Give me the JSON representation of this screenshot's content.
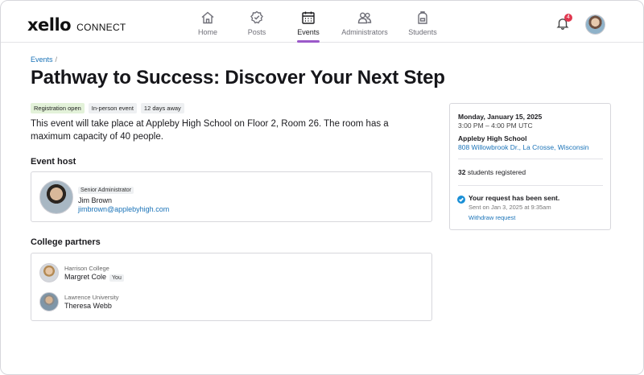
{
  "app": {
    "logo_word": "xello",
    "logo_sub": "CONNECT",
    "notification_count": "4"
  },
  "nav": {
    "items": [
      {
        "label": "Home",
        "icon": "home-icon"
      },
      {
        "label": "Posts",
        "icon": "badge-check-icon"
      },
      {
        "label": "Events",
        "icon": "calendar-icon",
        "active": true
      },
      {
        "label": "Administrators",
        "icon": "users-icon"
      },
      {
        "label": "Students",
        "icon": "backpack-icon"
      }
    ]
  },
  "breadcrumb": {
    "parent": "Events",
    "separator": "/"
  },
  "event": {
    "title": "Pathway to Success: Discover Your Next Step",
    "tags": [
      "Registration open",
      "In-person event",
      "12 days away"
    ],
    "description": "This event will take place at Appleby High School on Floor 2, Room 26. The room has a maximum capacity of 40 people."
  },
  "host": {
    "heading": "Event host",
    "role": "Senior Administrator",
    "name": "Jim Brown",
    "email": "jimbrown@applebyhigh.com"
  },
  "partners": {
    "heading": "College partners",
    "items": [
      {
        "school": "Harrison College",
        "name": "Margret Cole",
        "you_label": "You"
      },
      {
        "school": "Lawrence University",
        "name": "Theresa Webb",
        "you_label": ""
      }
    ]
  },
  "details": {
    "date": "Monday, January 15, 2025",
    "time": "3:00 PM – 4:00 PM UTC",
    "school": "Appleby High School",
    "address": "808 Willowbrook Dr., La Crosse, Wisconsin",
    "registered_count": "32",
    "registered_suffix": " students registered",
    "request_status": "Your request has been sent.",
    "request_sent_on": "Sent on Jan 3, 2025 at 9:35am",
    "withdraw_label": "Withdraw request"
  },
  "colors": {
    "accent": "#9b59c9",
    "link": "#1a73b8",
    "notification": "#e0374f",
    "status_check": "#1a8fd6",
    "tag_open_bg": "#e3f2d9"
  }
}
